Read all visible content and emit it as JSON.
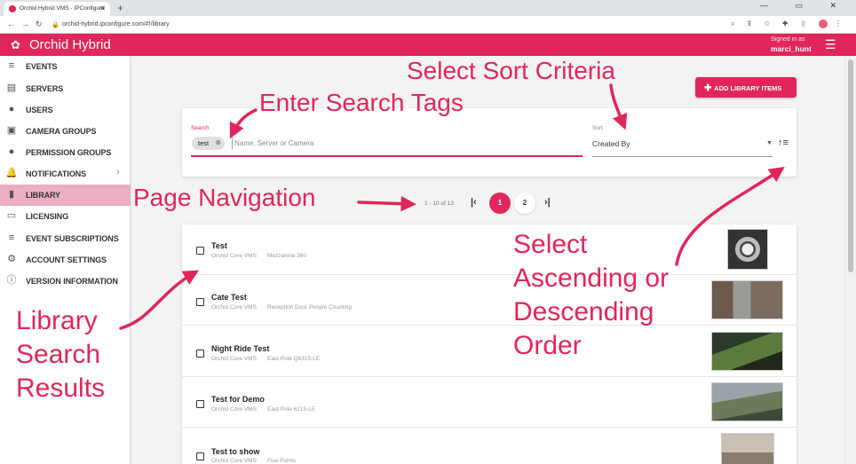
{
  "browser": {
    "tab_title": "Orchid Hybrid VMS - IPConfigure",
    "new_tab": "+",
    "url": "orchid-hybrid.ipconfigure.com/#!/library",
    "window_controls": "— ▭ ✕"
  },
  "header": {
    "brand": "Orchid Hybrid",
    "signed_in_label": "Signed in as",
    "username": "marci_hunt"
  },
  "sidebar": {
    "items": [
      {
        "label": "EVENTS",
        "icon": "events-icon"
      },
      {
        "label": "SERVERS",
        "icon": "servers-icon"
      },
      {
        "label": "USERS",
        "icon": "users-icon"
      },
      {
        "label": "CAMERA GROUPS",
        "icon": "camera-groups-icon"
      },
      {
        "label": "PERMISSION GROUPS",
        "icon": "permission-groups-icon"
      },
      {
        "label": "NOTIFICATIONS",
        "icon": "bell-icon"
      },
      {
        "label": "LIBRARY",
        "icon": "bookmark-icon"
      },
      {
        "label": "LICENSING",
        "icon": "license-icon"
      },
      {
        "label": "EVENT SUBSCRIPTIONS",
        "icon": "event-subscriptions-icon"
      },
      {
        "label": "ACCOUNT SETTINGS",
        "icon": "account-settings-icon"
      },
      {
        "label": "VERSION INFORMATION",
        "icon": "info-icon"
      }
    ],
    "active": "LIBRARY"
  },
  "toolbar": {
    "add_label": "ADD LIBRARY ITEMS"
  },
  "search": {
    "label": "Search",
    "chip": "test",
    "placeholder": "Name, Server or Camera",
    "sort_label": "Sort",
    "sort_value": "Created By"
  },
  "pagination": {
    "range": "1 - 10 of 13",
    "pages": [
      "1",
      "2"
    ],
    "current": "1"
  },
  "results": [
    {
      "title": "Test",
      "server": "Orchid Core VMS",
      "camera": "Mezzanine 360"
    },
    {
      "title": "Cate Test",
      "server": "Orchid Core VMS",
      "camera": "Reception Door People Counting"
    },
    {
      "title": "Night Ride Test",
      "server": "Orchid Core VMS",
      "camera": "East Pole Q6315-LE"
    },
    {
      "title": "Test for Demo",
      "server": "Orchid Core VMS",
      "camera": "East Pole 6215-LE"
    },
    {
      "title": "Test to show",
      "server": "Orchid Core VMS",
      "camera": "Five Points"
    }
  ],
  "annotations": {
    "sort_criteria": "Select Sort Criteria",
    "search_tags": "Enter Search Tags",
    "page_navigation": "Page Navigation",
    "order_line1": "Select",
    "order_line2": "Ascending or",
    "order_line3": "Descending",
    "order_line4": "Order",
    "results_line1": "Library",
    "results_line2": "Search",
    "results_line3": "Results"
  },
  "colors": {
    "accent": "#e0265a",
    "active_nav": "#ecaec1"
  }
}
